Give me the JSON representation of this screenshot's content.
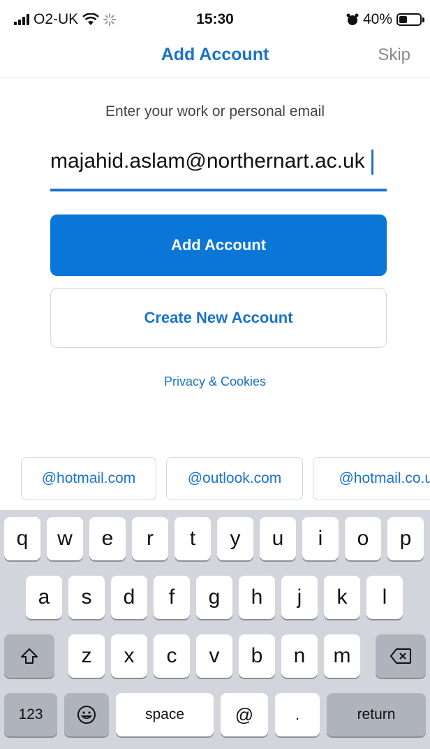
{
  "status_bar": {
    "carrier": "O2-UK",
    "time": "15:30",
    "battery_percent": "40%",
    "battery_level": 0.4,
    "icons": [
      "signal-icon",
      "wifi-icon",
      "loading-icon",
      "alarm-icon",
      "battery-icon"
    ]
  },
  "nav": {
    "title": "Add Account",
    "skip_label": "Skip"
  },
  "form": {
    "prompt": "Enter your work or personal email",
    "email_value": "majahid.aslam@northernart.ac.uk",
    "add_account_label": "Add Account",
    "create_account_label": "Create New Account",
    "privacy_label": "Privacy & Cookies"
  },
  "suggestions": [
    "@hotmail.com",
    "@outlook.com",
    "@hotmail.co.uk"
  ],
  "keyboard": {
    "row1": [
      "q",
      "w",
      "e",
      "r",
      "t",
      "y",
      "u",
      "i",
      "o",
      "p"
    ],
    "row2": [
      "a",
      "s",
      "d",
      "f",
      "g",
      "h",
      "j",
      "k",
      "l"
    ],
    "row3": [
      "z",
      "x",
      "c",
      "v",
      "b",
      "n",
      "m"
    ],
    "numbers_label": "123",
    "space_label": "space",
    "at_label": "@",
    "dot_label": ".",
    "return_label": "return"
  },
  "colors": {
    "accent": "#1a73c8",
    "primary_button": "#0a76d8",
    "keyboard_bg": "#d2d5db"
  }
}
